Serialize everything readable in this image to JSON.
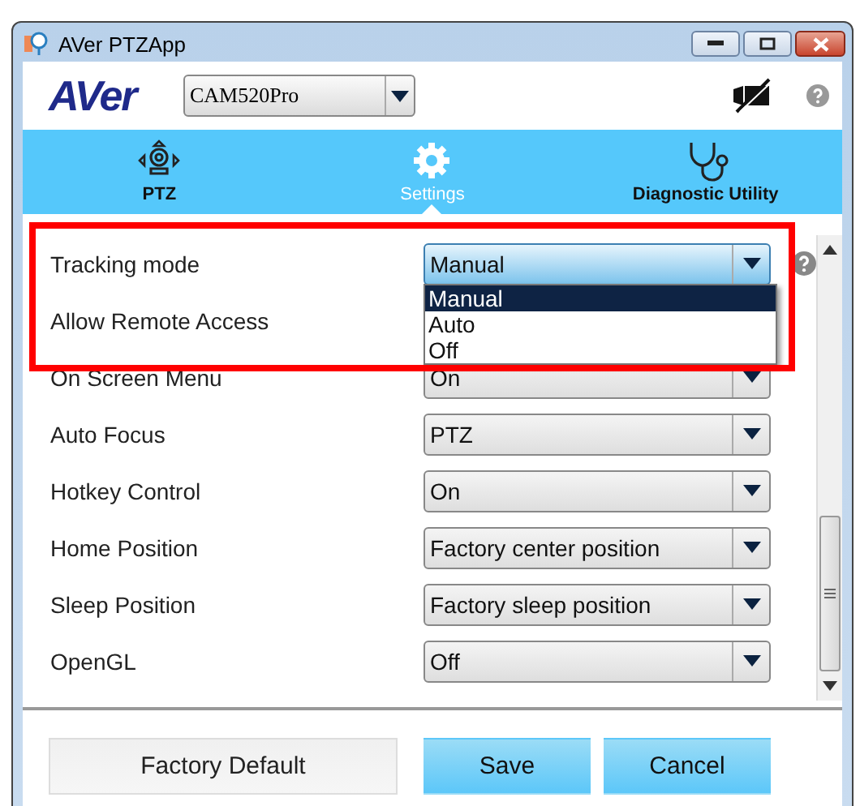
{
  "window": {
    "title": "AVer PTZApp"
  },
  "header": {
    "logo": "AVer",
    "camera": "CAM520Pro"
  },
  "tabs": [
    {
      "label": "PTZ",
      "selected": false
    },
    {
      "label": "Settings",
      "selected": true
    },
    {
      "label": "Diagnostic Utility",
      "selected": false
    }
  ],
  "settings": [
    {
      "label": "Tracking mode",
      "value": "Manual",
      "expanded": true,
      "help": true
    },
    {
      "label": "Allow Remote Access"
    },
    {
      "label": "On Screen Menu",
      "value": "On",
      "expanded": false
    },
    {
      "label": "Auto Focus",
      "value": "PTZ",
      "expanded": false
    },
    {
      "label": "Hotkey Control",
      "value": "On",
      "expanded": false
    },
    {
      "label": "Home Position",
      "value": "Factory center position",
      "expanded": false
    },
    {
      "label": "Sleep Position",
      "value": "Factory sleep position",
      "expanded": false
    },
    {
      "label": "OpenGL",
      "value": "Off",
      "expanded": false
    }
  ],
  "dropdown_options": [
    {
      "label": "Manual",
      "selected": true
    },
    {
      "label": "Auto",
      "selected": false
    },
    {
      "label": "Off",
      "selected": false
    }
  ],
  "buttons": [
    {
      "label": "Factory Default",
      "kind": "secondary"
    },
    {
      "label": "Save",
      "kind": "primary"
    },
    {
      "label": "Cancel",
      "kind": "primary"
    }
  ]
}
